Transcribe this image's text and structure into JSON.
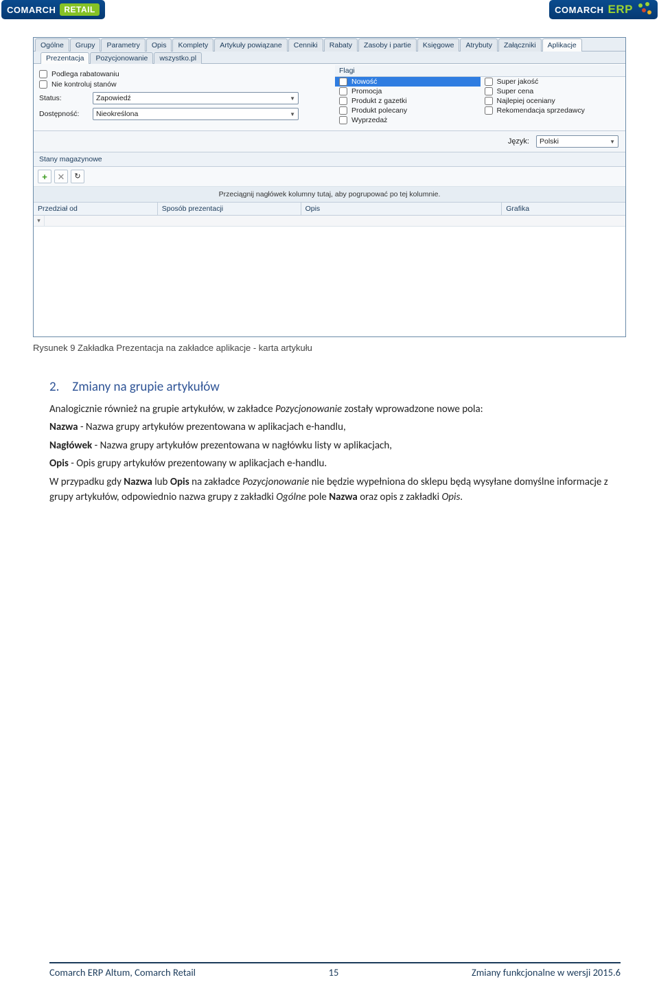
{
  "brand": {
    "left_main": "COMARCH",
    "left_accent": "RETAIL",
    "right_main": "COMARCH",
    "right_accent": "ERP"
  },
  "tabs_main": [
    "Ogólne",
    "Grupy",
    "Parametry",
    "Opis",
    "Komplety",
    "Artykuły powiązane",
    "Cenniki",
    "Rabaty",
    "Zasoby i partie",
    "Księgowe",
    "Atrybuty",
    "Załączniki",
    "Aplikacje"
  ],
  "tabs_sub": [
    "Prezentacja",
    "Pozycjonowanie",
    "wszystko.pl"
  ],
  "left_panel": {
    "chk1": "Podlega rabatowaniu",
    "chk2": "Nie kontroluj stanów",
    "status_label": "Status:",
    "status_value": "Zapowiedź",
    "avail_label": "Dostępność:",
    "avail_value": "Nieokreślona"
  },
  "flags": {
    "title": "Flagi",
    "col1": [
      "Nowość",
      "Promocja",
      "Produkt z gazetki",
      "Produkt polecany",
      "Wyprzedaż"
    ],
    "col2": [
      "Super jakość",
      "Super cena",
      "Najlepiej oceniany",
      "Rekomendacja sprzedawcy"
    ]
  },
  "lang": {
    "label": "Język:",
    "value": "Polski"
  },
  "stock": {
    "title": "Stany magazynowe",
    "hint": "Przeciągnij nagłówek kolumny tutaj, aby pogrupować po tej kolumnie.",
    "cols": [
      "Przedział od",
      "Sposób prezentacji",
      "Opis",
      "Grafika"
    ]
  },
  "caption": "Rysunek 9 Zakładka Prezentacja na zakładce aplikacje - karta artykułu",
  "doc": {
    "heading": "2. Zmiany na grupie artykułów",
    "p1_a": "Analogicznie również na grupie artykułów, w zakładce ",
    "p1_i": "Pozycjonowanie",
    "p1_b": " zostały wprowadzone nowe pola:",
    "li1_b": "Nazwa",
    "li1": " - Nazwa grupy artykułów prezentowana w aplikacjach e-handlu,",
    "li2_b": "Nagłówek",
    "li2": " - Nazwa grupy artykułów prezentowana w nagłówku listy w aplikacjach,",
    "li3_b": "Opis",
    "li3": " - Opis grupy artykułów prezentowany w aplikacjach e-handlu.",
    "p2_a": " W przypadku gdy ",
    "p2_b1": "Nazwa",
    "p2_c": " lub ",
    "p2_b2": "Opis",
    "p2_d": " na zakładce ",
    "p2_i1": "Pozycjonowanie",
    "p2_e": " nie będzie wypełniona do sklepu będą wysyłane domyślne informacje z grupy artykułów, odpowiednio nazwa grupy z zakładki ",
    "p2_i2": "Ogólne",
    "p2_f": " pole ",
    "p2_b3": "Nazwa",
    "p2_g": " oraz opis z zakładki ",
    "p2_i3": "Opis",
    "p2_h": "."
  },
  "footer": {
    "left": "Comarch ERP Altum, Comarch Retail",
    "center": "15",
    "right": "Zmiany funkcjonalne w wersji 2015.6"
  }
}
